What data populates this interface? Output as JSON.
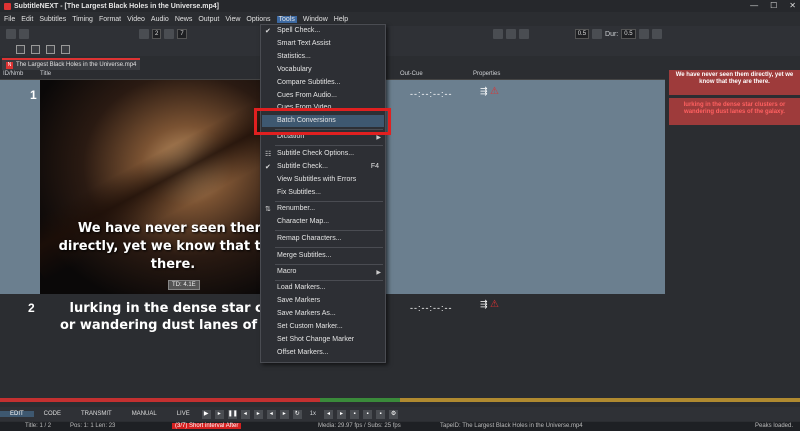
{
  "window": {
    "title": "SubtitleNEXT - [The Largest Black Holes in the Universe.mp4]"
  },
  "menubar": [
    "File",
    "Edit",
    "Subtitles",
    "Timing",
    "Format",
    "Video",
    "Audio",
    "News",
    "Output",
    "View",
    "Options",
    "Tools",
    "Window",
    "Help"
  ],
  "toolbar": {
    "size_a": "2",
    "size_b": "7",
    "speed": "0.5",
    "dur_label": "Dur:",
    "dur_value": "0.5"
  },
  "tab": {
    "label": "The Largest Black Holes in the Universe.mp4"
  },
  "grid": {
    "headers": {
      "id": "ID/Nmb",
      "title": "Title",
      "outcue": "Out-Cue",
      "properties": "Properties"
    },
    "rows": [
      {
        "num": "1",
        "text_line1": "We have never seen them",
        "text_line2": "directly, yet we know that they",
        "text_line3": "there.",
        "outcue": "--:--:--:--",
        "td": "TD: 4.1E"
      },
      {
        "num": "2",
        "text_line1": "lurking in the dense star clu",
        "text_line2": "or wandering  dust lanes of the",
        "outcue": "--:--:--:--"
      }
    ]
  },
  "right_panel": {
    "sub1": "We have never seen them directly, yet we know that they are there.",
    "sub2": "lurking in the dense star clusters or wandering  dust lanes of the galaxy."
  },
  "tools_menu": {
    "items": [
      {
        "label": "Spell Check...",
        "check": true
      },
      {
        "label": "Smart Text Assist"
      },
      {
        "label": "Statistics..."
      },
      {
        "label": "Vocabulary"
      },
      {
        "label": "Compare Subtitles..."
      },
      {
        "label": "Cues From Audio..."
      },
      {
        "label": "Cues From Video..."
      },
      {
        "label": "Batch Conversions",
        "highlighted": true
      },
      {
        "label": "Dictation",
        "submenu": true
      },
      {
        "label": "Subtitle Check Options..."
      },
      {
        "label": "Subtitle Check...",
        "shortcut": "F4"
      },
      {
        "label": "View Subtitles with Errors"
      },
      {
        "label": "Fix Subtitles..."
      },
      {
        "label": "Renumber..."
      },
      {
        "label": "Character Map..."
      },
      {
        "label": "Remap Characters..."
      },
      {
        "label": "Merge Subtitles..."
      },
      {
        "label": "Macro",
        "submenu": true
      },
      {
        "label": "Load Markers..."
      },
      {
        "label": "Save Markers"
      },
      {
        "label": "Save Markers As..."
      },
      {
        "label": "Set Custom Marker..."
      },
      {
        "label": "Set Shot Change Marker"
      },
      {
        "label": "Offset Markers..."
      }
    ]
  },
  "transport": {
    "modes": [
      "EDIT",
      "CODE",
      "TRANSMIT",
      "MANUAL",
      "LIVE"
    ],
    "speed": "1x"
  },
  "status": {
    "title": "Title:  1 / 2",
    "pos": "Pos: 1:  1  Len: 23",
    "error": "(3/7) Short interval After",
    "media": "Media: 29.97 fps / Subs: 25 fps",
    "tapeid": "TapeID: The Largest Black Holes in the Universe.mp4",
    "peaks": "Peaks loaded."
  }
}
